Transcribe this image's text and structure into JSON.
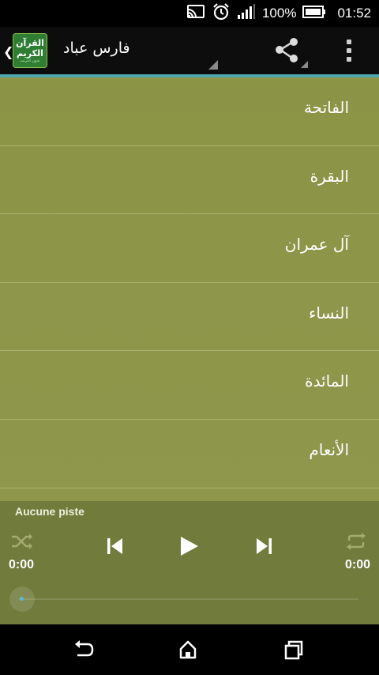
{
  "status_bar": {
    "battery_percent": "100%",
    "time": "01:52",
    "icons": [
      "cast-icon",
      "alarm-icon",
      "signal-icon",
      "battery-icon"
    ]
  },
  "action_bar": {
    "logo_line1": "القرآن",
    "logo_line2": "الكريم",
    "logo_line3": "بدون انترنت",
    "title": "فارس عباد",
    "share_icon": "share-icon",
    "overflow_icon": "overflow-menu-icon",
    "accent_color": "#4fa6b4"
  },
  "list": {
    "items": [
      {
        "label": "الفاتحة"
      },
      {
        "label": "البقرة"
      },
      {
        "label": "آل عمران"
      },
      {
        "label": "النساء"
      },
      {
        "label": "المائدة"
      },
      {
        "label": "الأنعام"
      }
    ],
    "background_color": "#8d9549"
  },
  "player": {
    "track_label": "Aucune piste",
    "elapsed": "0:00",
    "duration": "0:00",
    "progress": 0,
    "controls": [
      "shuffle-icon",
      "previous-icon",
      "play-icon",
      "next-icon",
      "repeat-icon"
    ]
  },
  "nav_bar": {
    "buttons": [
      "back-icon",
      "home-icon",
      "recents-icon"
    ]
  }
}
